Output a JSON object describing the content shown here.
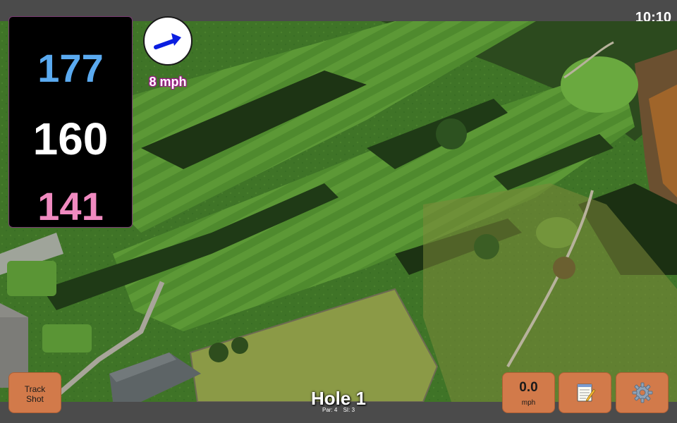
{
  "status": {
    "clock": "10:10"
  },
  "distances": {
    "back": "177",
    "center": "160",
    "front": "141"
  },
  "wind": {
    "speed": "8 mph",
    "icon": "wind-direction-arrow-icon"
  },
  "hole": {
    "title": "Hole 1",
    "par": "Par: 4",
    "si": "SI: 3"
  },
  "buttons": {
    "track_shot": "Track\nShot",
    "speed_value": "0.0",
    "speed_unit": "mph",
    "notes_icon": "notepad-icon",
    "settings_icon": "gear-icon"
  },
  "colors": {
    "back_distance": "#5aaaf0",
    "center_distance": "#ffffff",
    "front_distance": "#f08ac0",
    "button": "#d27a4a",
    "wind_text_outline": "#a01a8c"
  }
}
